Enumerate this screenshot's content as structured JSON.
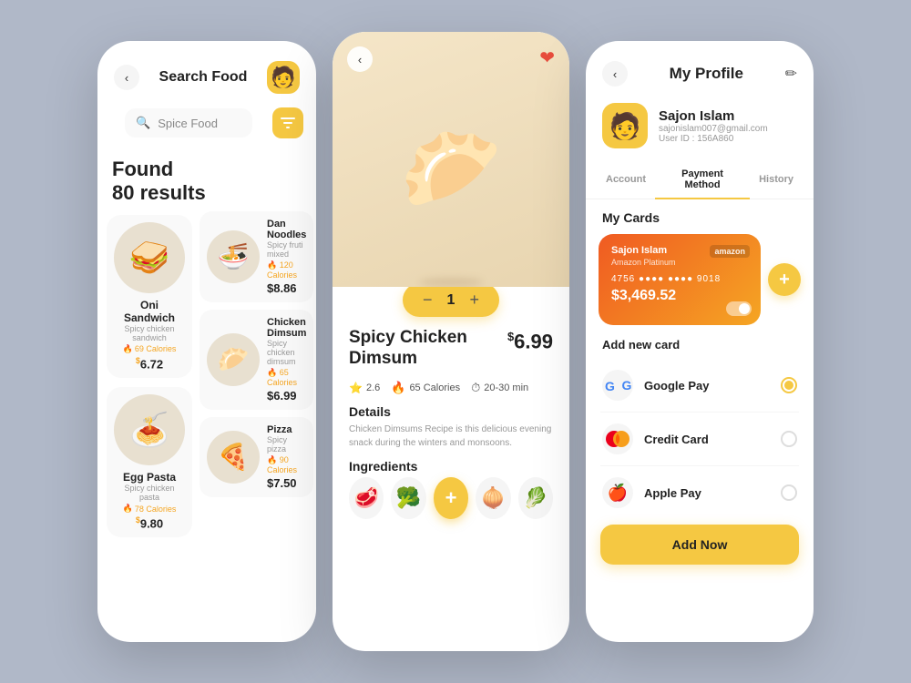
{
  "phone1": {
    "header": {
      "back_label": "‹",
      "title": "Search Food",
      "avatar_emoji": "🧑"
    },
    "search": {
      "placeholder": "Spice Food",
      "filter_icon": "⚙"
    },
    "results_line1": "Found",
    "results_line2": "80 results",
    "left_foods": [
      {
        "emoji": "🥪",
        "name": "Oni Sandwich",
        "sub": "Spicy chicken sandwich",
        "calories": "69 Calories",
        "price": "6.72"
      },
      {
        "emoji": "🍝",
        "name": "Egg Pasta",
        "sub": "Spicy chicken pasta",
        "calories": "78 Calories",
        "price": "9.80"
      }
    ],
    "right_foods": [
      {
        "emoji": "🍜",
        "name": "Dan Noodles",
        "sub": "Spicy fruti mixed",
        "calories": "120 Calories",
        "price": "8.86"
      },
      {
        "emoji": "🥟",
        "name": "Chicken Dimsum",
        "sub": "Spicy chicken dimsum",
        "calories": "65 Calories",
        "price": "6.99"
      },
      {
        "emoji": "🍕",
        "name": "Pizza",
        "sub": "Spicy pizza",
        "calories": "90 Calories",
        "price": "7.50"
      }
    ]
  },
  "phone2": {
    "back_label": "‹",
    "hero_emoji": "🥟",
    "quantity": "1",
    "qty_minus": "−",
    "qty_plus": "+",
    "food_name": "Spicy Chicken Dimsum",
    "price_symbol": "$",
    "price": "6.99",
    "rating": "2.6",
    "calories": "65 Calories",
    "time": "20-30 min",
    "details_label": "Details",
    "description": "Chicken Dimsums Recipe is this delicious evening snack during the winters and monsoons.",
    "ingredients_label": "Ingredients",
    "ingredients": [
      "🥩",
      "🥦",
      "🧅",
      "🥬"
    ],
    "add_icon": "+"
  },
  "phone3": {
    "back_label": "‹",
    "title": "My Profile",
    "edit_icon": "✏",
    "avatar_emoji": "🧑",
    "user_name": "Sajon Islam",
    "user_email": "sajonislam007@gmail.com",
    "user_id": "User ID : 156A860",
    "tabs": [
      {
        "label": "Account",
        "active": false
      },
      {
        "label": "Payment Method",
        "active": true
      },
      {
        "label": "History",
        "active": false
      }
    ],
    "my_cards_label": "My Cards",
    "card": {
      "holder": "Sajon Islam",
      "brand": "amazon",
      "type": "Amazon Platinum",
      "number": "4756  ●●●●  ●●●●  9018",
      "balance": "$3,469.52"
    },
    "add_card_icon": "+",
    "add_new_label": "Add new card",
    "payment_options": [
      {
        "icon": "G",
        "label": "Google Pay",
        "selected": true,
        "icon_style": "google"
      },
      {
        "icon": "💳",
        "label": "Credit Card",
        "selected": false,
        "icon_style": "mastercard"
      },
      {
        "icon": "🍎",
        "label": "Apple Pay",
        "selected": false,
        "icon_style": "apple"
      }
    ],
    "add_now_label": "Add Now"
  }
}
